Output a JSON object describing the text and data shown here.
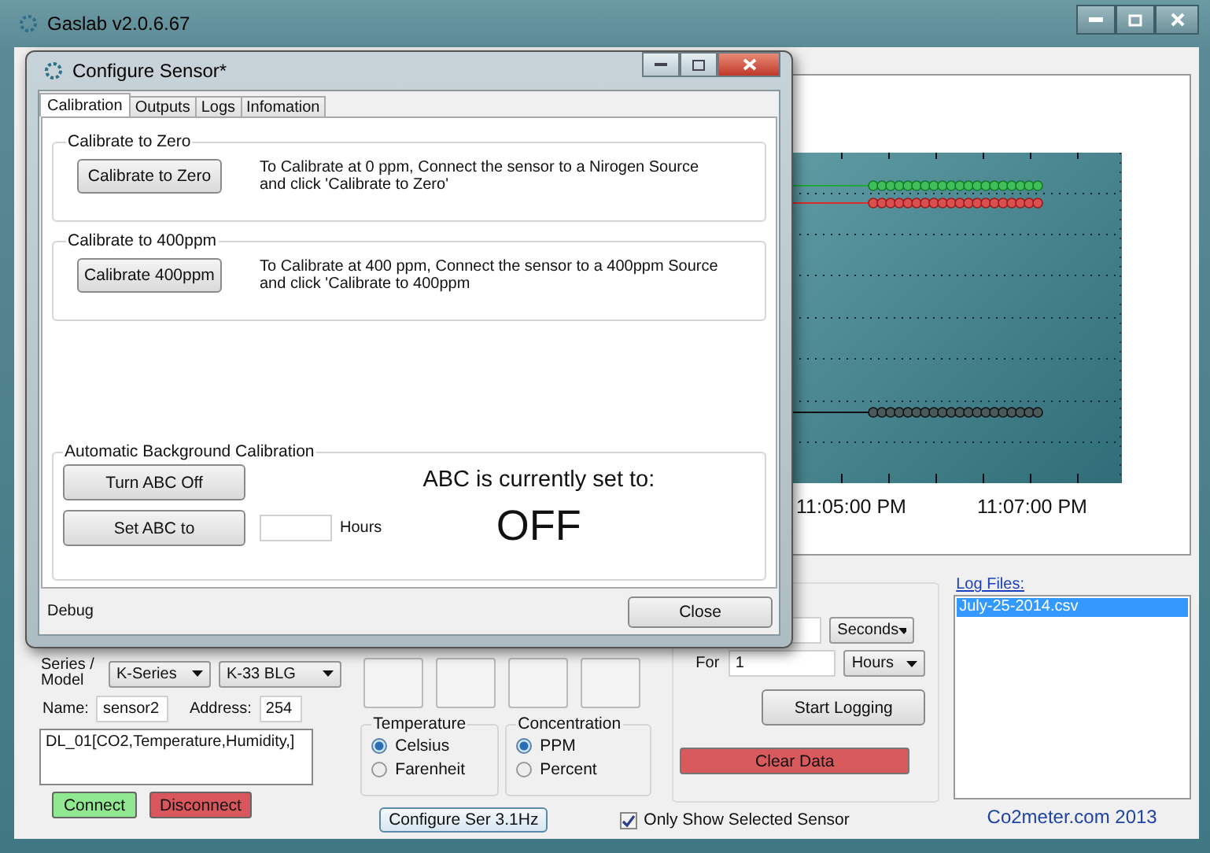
{
  "window": {
    "title": "Gaslab v2.0.6.67"
  },
  "chart": {
    "time_labels": [
      "11:05:00 PM",
      "11:07:00 PM"
    ]
  },
  "sensor": {
    "series_label": "Series / Model",
    "series": "K-Series",
    "model": "K-33 BLG",
    "name_label": "Name:",
    "name": "sensor2",
    "address_label": "Address:",
    "address": "254",
    "output": "DL_01[CO2,Temperature,Humidity,]",
    "buttons": [
      {
        "label": "Connect",
        "color": "#90e890"
      },
      {
        "label": "Disconnect",
        "color": "#d9575c"
      }
    ]
  },
  "temperature": {
    "title": "Temperature",
    "options": [
      {
        "label": "Celsius",
        "selected": true
      },
      {
        "label": "Farenheit",
        "selected": false
      }
    ]
  },
  "concentration": {
    "title": "Concentration",
    "options": [
      {
        "label": "PPM",
        "selected": true
      },
      {
        "label": "Percent",
        "selected": false
      }
    ]
  },
  "configure_button": "Configure Ser 3.1Hz",
  "only_selected": {
    "label": "Only Show Selected Sensor",
    "checked": true
  },
  "logging": {
    "interval_unit": "Seconds",
    "for_label": "For",
    "duration": "1",
    "duration_unit": "Hours",
    "start_button": "Start Logging",
    "clear_button": "Clear Data"
  },
  "log_files": {
    "title": "Log Files:",
    "files": [
      {
        "name": "July-25-2014.csv",
        "selected": true
      }
    ]
  },
  "footer": "Co2meter.com 2013",
  "dialog": {
    "title": "Configure Sensor*",
    "tabs": [
      {
        "label": "Calibration",
        "selected": true
      },
      {
        "label": "Outputs",
        "selected": false
      },
      {
        "label": "Logs",
        "selected": false
      },
      {
        "label": "Infomation",
        "selected": false
      }
    ],
    "zero": {
      "title": "Calibrate to Zero",
      "button": "Calibrate to Zero",
      "text": "To Calibrate at 0 ppm, Connect the sensor to a Nirogen Source\nand click 'Calibrate to Zero'"
    },
    "span": {
      "title": "Calibrate to 400ppm",
      "button": "Calibrate 400ppm",
      "text": "To Calibrate at 400 ppm, Connect the sensor to a 400ppm Source\nand click 'Calibrate to 400ppm"
    },
    "abc": {
      "title": "Automatic Background Calibration",
      "off_button": "Turn ABC Off",
      "set_button": "Set ABC to",
      "hours_label": "Hours",
      "status_label": "ABC is currently set to:",
      "status": "OFF"
    },
    "status": "Debug",
    "close_button": "Close"
  }
}
